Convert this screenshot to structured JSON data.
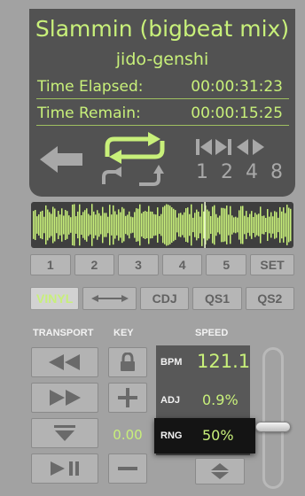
{
  "track": {
    "title": "Slammin (bigbeat mix)",
    "artist": "jido-genshi"
  },
  "time": {
    "elapsed_label": "Time Elapsed:",
    "elapsed_value": "00:00:31:23",
    "remain_label": "Time Remain:",
    "remain_value": "00:00:15:25"
  },
  "loop": {
    "multipliers": [
      "1",
      "2",
      "4",
      "8"
    ]
  },
  "progress": {
    "played_fraction": 0.66
  },
  "cues": {
    "labels": [
      "1",
      "2",
      "3",
      "4",
      "5"
    ],
    "set_label": "SET"
  },
  "modes": {
    "vinyl": "VINYL",
    "cdj": "CDJ",
    "qs1": "QS1",
    "qs2": "QS2"
  },
  "sections": {
    "transport": "TRANSPORT",
    "key": "KEY",
    "speed": "SPEED"
  },
  "key": {
    "value": "0.00"
  },
  "speed": {
    "bpm_label": "BPM",
    "bpm_value": "121.1",
    "adj_label": "ADJ",
    "adj_value": "0.9%",
    "rng_label": "RNG",
    "rng_value": "50%"
  },
  "pitch": {
    "level": 0.56
  },
  "colors": {
    "accent": "#c8f07a",
    "display_bg": "#525252",
    "panel_bg": "#a2a2a2"
  }
}
